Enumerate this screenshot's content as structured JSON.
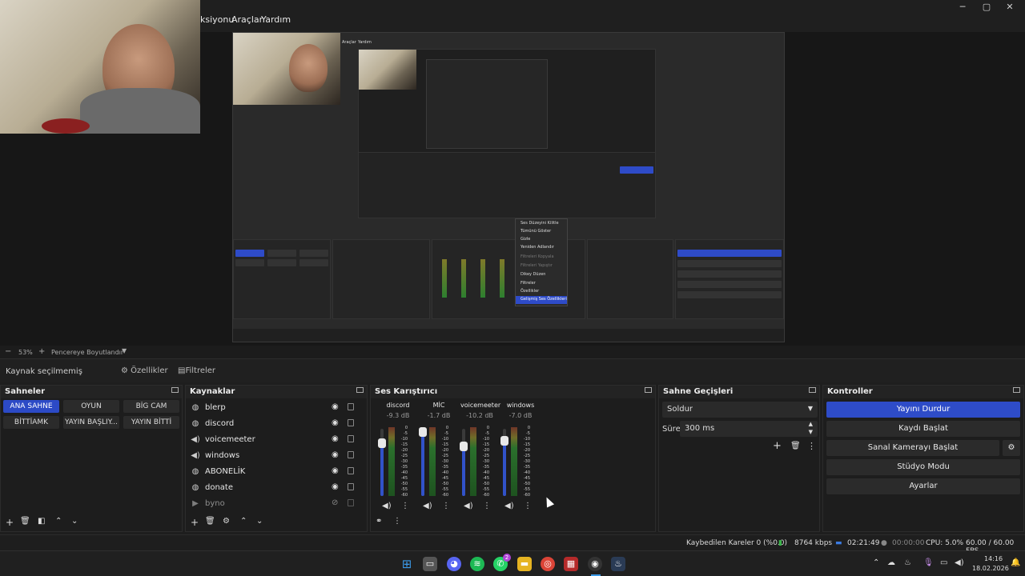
{
  "menu": {
    "items": [
      "ksiyonu",
      "Araçlar",
      "Yardım"
    ]
  },
  "preview": {
    "zoom": "53%",
    "resize_label": "Pencereye Boyutlandır",
    "nested_menu_items": [
      "Araçlar",
      "Yardım"
    ],
    "nested_context_menu": [
      "Ses Düzeyini Kilitle",
      "Tümünü Göster",
      "Gizle",
      "Yeniden Adlandır",
      "Filtreleri Kopyala",
      "Filtreleri Yapıştır",
      "Dikey Düzen",
      "Filtreler",
      "Özellikler",
      "Gelişmiş Ses Özellikleri"
    ]
  },
  "sourcebar": {
    "no_source": "Kaynak seçilmemiş",
    "properties": "Özellikler",
    "filters": "Filtreler"
  },
  "scenes": {
    "title": "Sahneler",
    "items": [
      "ANA SAHNE",
      "OYUN",
      "BİG CAM",
      "BİTTİAMK",
      "YAYIN BAŞLIY...",
      "YAYIN BİTTİ"
    ],
    "active": "ANA SAHNE"
  },
  "sources": {
    "title": "Kaynaklar",
    "items": [
      {
        "label": "blerp",
        "icon": "globe-icon"
      },
      {
        "label": "discord",
        "icon": "globe-icon"
      },
      {
        "label": "voicemeeter",
        "icon": "speaker-icon"
      },
      {
        "label": "windows",
        "icon": "speaker-icon"
      },
      {
        "label": "ABONELİK",
        "icon": "globe-icon"
      },
      {
        "label": "donate",
        "icon": "globe-icon"
      },
      {
        "label": "byno",
        "icon": "play-icon"
      }
    ]
  },
  "mixer": {
    "title": "Ses Karıştırıcı",
    "channels": [
      {
        "name": "discord",
        "db": "-9.3 dB",
        "level": 0.78
      },
      {
        "name": "MİC",
        "db": "-1.7 dB",
        "level": 0.95
      },
      {
        "name": "voicemeeter",
        "db": "-10.2 dB",
        "level": 0.74
      },
      {
        "name": "windows",
        "db": "-7.0 dB",
        "level": 0.82
      }
    ],
    "scale": [
      "0",
      "-5",
      "-10",
      "-15",
      "-20",
      "-25",
      "-30",
      "-35",
      "-40",
      "-45",
      "-50",
      "-55",
      "-60"
    ]
  },
  "transitions": {
    "title": "Sahne Geçişleri",
    "selected": "Soldur",
    "duration_label": "Süre",
    "duration_value": "300 ms"
  },
  "controls": {
    "title": "Kontroller",
    "buttons": [
      "Yayını Durdur",
      "Kaydı Başlat",
      "Sanal Kamerayı Başlat",
      "Stüdyo Modu",
      "Ayarlar"
    ]
  },
  "status": {
    "dropped": "Kaybedilen Kareler 0 (%0.0)",
    "bitrate": "8764 kbps",
    "stream_time": "02:21:49",
    "rec_time": "00:00:00",
    "cpu": "CPU: 5.0%",
    "fps": "60.00 / 60.00 FPS"
  },
  "taskbar": {
    "time": "14:16",
    "date": "18.02.2026",
    "badge": "2"
  },
  "colors": {
    "accent": "#2e4cc8",
    "panel": "#1d1d1d",
    "meter_green": "#2d7f2f"
  }
}
